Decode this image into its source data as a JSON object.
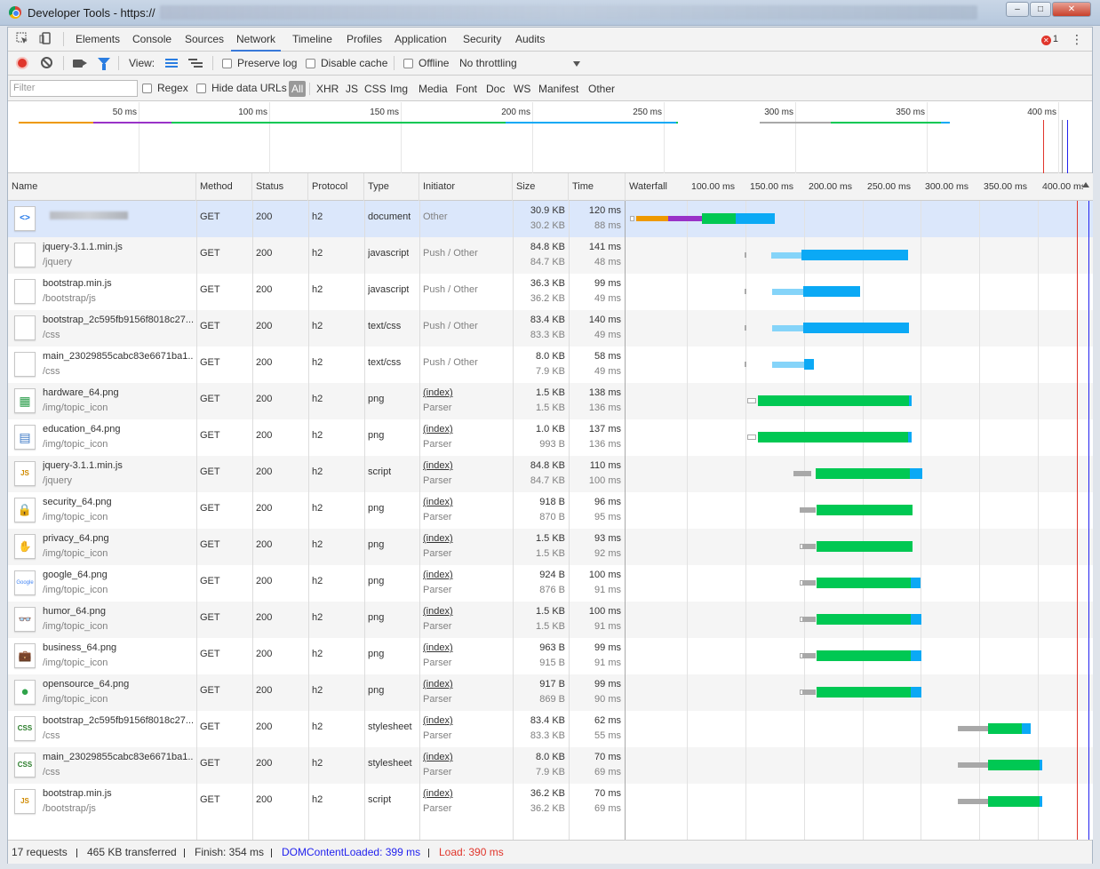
{
  "window": {
    "title": "Developer Tools - https://",
    "minimize": "–",
    "maximize": "□",
    "close": "✕"
  },
  "tabs": [
    "Elements",
    "Console",
    "Sources",
    "Network",
    "Timeline",
    "Profiles",
    "Application",
    "Security",
    "Audits"
  ],
  "active_tab": "Network",
  "error_count": "1",
  "network_toolbar": {
    "view_label": "View:",
    "preserve_log": "Preserve log",
    "disable_cache": "Disable cache",
    "offline": "Offline",
    "throttling": "No throttling"
  },
  "filter_bar": {
    "placeholder": "Filter",
    "regex": "Regex",
    "hide_data_urls": "Hide data URLs",
    "types": [
      "All",
      "XHR",
      "JS",
      "CSS",
      "Img",
      "Media",
      "Font",
      "Doc",
      "WS",
      "Manifest",
      "Other"
    ]
  },
  "overview": {
    "ticks": [
      "50 ms",
      "100 ms",
      "150 ms",
      "200 ms",
      "250 ms",
      "300 ms",
      "350 ms",
      "400 ms"
    ]
  },
  "columns": [
    "Name",
    "Method",
    "Status",
    "Protocol",
    "Type",
    "Initiator",
    "Size",
    "Time",
    "Waterfall"
  ],
  "waterfall_ticks": [
    "100.00 ms",
    "150.00 ms",
    "200.00 ms",
    "250.00 ms",
    "300.00 ms",
    "350.00 ms",
    "400.00 ms"
  ],
  "requests": [
    {
      "name": "",
      "path": "",
      "method": "GET",
      "status": "200",
      "protocol": "h2",
      "type": "document",
      "initiator": "Other",
      "initiator2": "",
      "size": "30.9 KB",
      "size2": "30.2 KB",
      "time": "120 ms",
      "time2": "88 ms",
      "icon": "html-doc-icon",
      "icon_text": "<>"
    },
    {
      "name": "jquery-3.1.1.min.js",
      "path": "/jquery",
      "method": "GET",
      "status": "200",
      "protocol": "h2",
      "type": "javascript",
      "initiator": "Push / Other",
      "initiator2": "",
      "size": "84.8 KB",
      "size2": "84.7 KB",
      "time": "141 ms",
      "time2": "48 ms",
      "icon": "blank-file-icon",
      "icon_text": ""
    },
    {
      "name": "bootstrap.min.js",
      "path": "/bootstrap/js",
      "method": "GET",
      "status": "200",
      "protocol": "h2",
      "type": "javascript",
      "initiator": "Push / Other",
      "initiator2": "",
      "size": "36.3 KB",
      "size2": "36.2 KB",
      "time": "99 ms",
      "time2": "49 ms",
      "icon": "blank-file-icon",
      "icon_text": ""
    },
    {
      "name": "bootstrap_2c595fb9156f8018c27...",
      "path": "/css",
      "method": "GET",
      "status": "200",
      "protocol": "h2",
      "type": "text/css",
      "initiator": "Push / Other",
      "initiator2": "",
      "size": "83.4 KB",
      "size2": "83.3 KB",
      "time": "140 ms",
      "time2": "49 ms",
      "icon": "blank-file-icon",
      "icon_text": ""
    },
    {
      "name": "main_23029855cabc83e6671ba1...",
      "path": "/css",
      "method": "GET",
      "status": "200",
      "protocol": "h2",
      "type": "text/css",
      "initiator": "Push / Other",
      "initiator2": "",
      "size": "8.0 KB",
      "size2": "7.9 KB",
      "time": "58 ms",
      "time2": "49 ms",
      "icon": "blank-file-icon",
      "icon_text": ""
    },
    {
      "name": "hardware_64.png",
      "path": "/img/topic_icon",
      "method": "GET",
      "status": "200",
      "protocol": "h2",
      "type": "png",
      "initiator": "(index)",
      "initiator2": "Parser",
      "size": "1.5 KB",
      "size2": "1.5 KB",
      "time": "138 ms",
      "time2": "136 ms",
      "icon": "chip-icon",
      "icon_text": "▦"
    },
    {
      "name": "education_64.png",
      "path": "/img/topic_icon",
      "method": "GET",
      "status": "200",
      "protocol": "h2",
      "type": "png",
      "initiator": "(index)",
      "initiator2": "Parser",
      "size": "1.0 KB",
      "size2": "993 B",
      "time": "137 ms",
      "time2": "136 ms",
      "icon": "education-icon",
      "icon_text": "▤"
    },
    {
      "name": "jquery-3.1.1.min.js",
      "path": "/jquery",
      "method": "GET",
      "status": "200",
      "protocol": "h2",
      "type": "script",
      "initiator": "(index)",
      "initiator2": "Parser",
      "size": "84.8 KB",
      "size2": "84.7 KB",
      "time": "110 ms",
      "time2": "100 ms",
      "icon": "js-file-icon",
      "icon_text": "JS"
    },
    {
      "name": "security_64.png",
      "path": "/img/topic_icon",
      "method": "GET",
      "status": "200",
      "protocol": "h2",
      "type": "png",
      "initiator": "(index)",
      "initiator2": "Parser",
      "size": "918 B",
      "size2": "870 B",
      "time": "96 ms",
      "time2": "95 ms",
      "icon": "lock-icon",
      "icon_text": "🔒"
    },
    {
      "name": "privacy_64.png",
      "path": "/img/topic_icon",
      "method": "GET",
      "status": "200",
      "protocol": "h2",
      "type": "png",
      "initiator": "(index)",
      "initiator2": "Parser",
      "size": "1.5 KB",
      "size2": "1.5 KB",
      "time": "93 ms",
      "time2": "92 ms",
      "icon": "privacy-hand-icon",
      "icon_text": "✋"
    },
    {
      "name": "google_64.png",
      "path": "/img/topic_icon",
      "method": "GET",
      "status": "200",
      "protocol": "h2",
      "type": "png",
      "initiator": "(index)",
      "initiator2": "Parser",
      "size": "924 B",
      "size2": "876 B",
      "time": "100 ms",
      "time2": "91 ms",
      "icon": "google-logo-icon",
      "icon_text": "Google"
    },
    {
      "name": "humor_64.png",
      "path": "/img/topic_icon",
      "method": "GET",
      "status": "200",
      "protocol": "h2",
      "type": "png",
      "initiator": "(index)",
      "initiator2": "Parser",
      "size": "1.5 KB",
      "size2": "1.5 KB",
      "time": "100 ms",
      "time2": "91 ms",
      "icon": "glasses-icon",
      "icon_text": "👓"
    },
    {
      "name": "business_64.png",
      "path": "/img/topic_icon",
      "method": "GET",
      "status": "200",
      "protocol": "h2",
      "type": "png",
      "initiator": "(index)",
      "initiator2": "Parser",
      "size": "963 B",
      "size2": "915 B",
      "time": "99 ms",
      "time2": "91 ms",
      "icon": "briefcase-icon",
      "icon_text": "💼"
    },
    {
      "name": "opensource_64.png",
      "path": "/img/topic_icon",
      "method": "GET",
      "status": "200",
      "protocol": "h2",
      "type": "png",
      "initiator": "(index)",
      "initiator2": "Parser",
      "size": "917 B",
      "size2": "869 B",
      "time": "99 ms",
      "time2": "90 ms",
      "icon": "opensource-icon",
      "icon_text": "●"
    },
    {
      "name": "bootstrap_2c595fb9156f8018c27...",
      "path": "/css",
      "method": "GET",
      "status": "200",
      "protocol": "h2",
      "type": "stylesheet",
      "initiator": "(index)",
      "initiator2": "Parser",
      "size": "83.4 KB",
      "size2": "83.3 KB",
      "time": "62 ms",
      "time2": "55 ms",
      "icon": "css-file-icon",
      "icon_text": "CSS"
    },
    {
      "name": "main_23029855cabc83e6671ba1...",
      "path": "/css",
      "method": "GET",
      "status": "200",
      "protocol": "h2",
      "type": "stylesheet",
      "initiator": "(index)",
      "initiator2": "Parser",
      "size": "8.0 KB",
      "size2": "7.9 KB",
      "time": "70 ms",
      "time2": "69 ms",
      "icon": "css-file-icon",
      "icon_text": "CSS"
    },
    {
      "name": "bootstrap.min.js",
      "path": "/bootstrap/js",
      "method": "GET",
      "status": "200",
      "protocol": "h2",
      "type": "script",
      "initiator": "(index)",
      "initiator2": "Parser",
      "size": "36.2 KB",
      "size2": "36.2 KB",
      "time": "70 ms",
      "time2": "69 ms",
      "icon": "js-file-icon",
      "icon_text": "JS"
    }
  ],
  "status_bar": {
    "requests": "17 requests",
    "transferred": "465 KB transferred",
    "finish": "Finish: 354 ms",
    "dom_content_loaded": "DOMContentLoaded: 399 ms",
    "load": "Load: 390 ms"
  },
  "colors": {
    "accent": "#3879d9",
    "content_download": "#0ba9f5",
    "waiting_ttfb": "#00c853",
    "dom_content_loaded": "#2222ee",
    "load": "#e0352b"
  }
}
